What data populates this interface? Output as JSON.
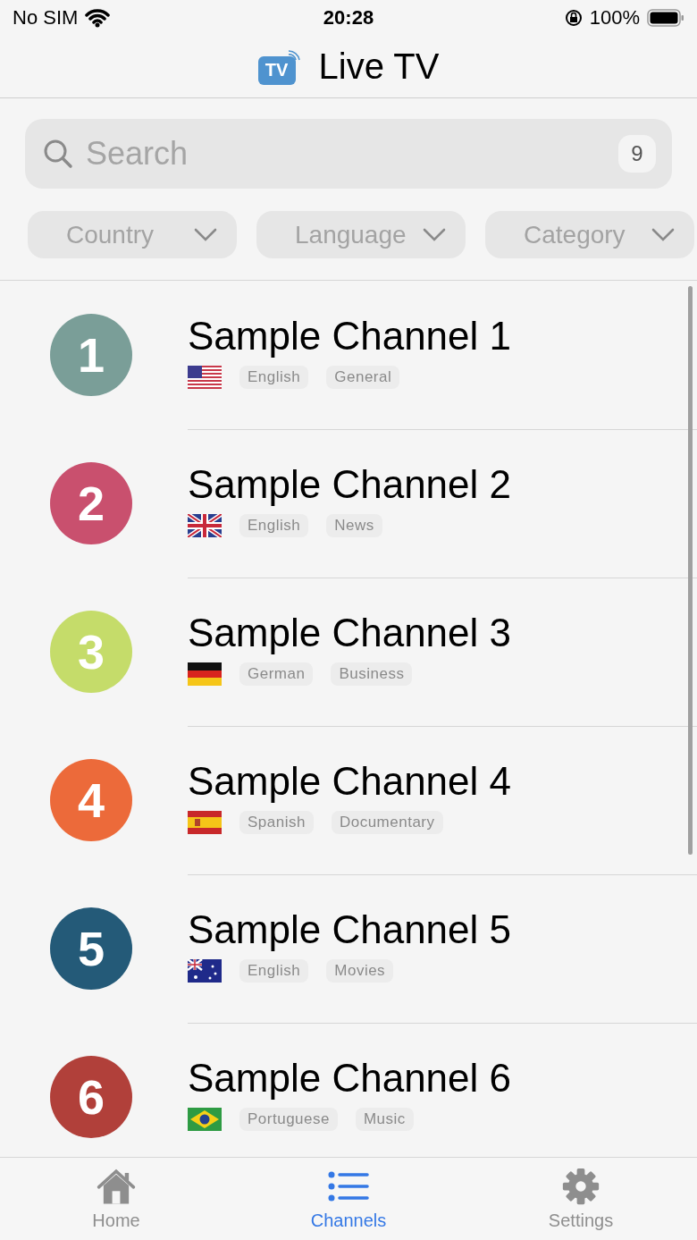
{
  "status_bar": {
    "carrier": "No SIM",
    "time": "20:28",
    "battery": "100%"
  },
  "header": {
    "title": "Live TV",
    "logo_text": "TV"
  },
  "search": {
    "placeholder": "Search",
    "count": "9"
  },
  "filters": [
    {
      "label": "Country"
    },
    {
      "label": "Language"
    },
    {
      "label": "Category"
    }
  ],
  "channels": [
    {
      "number": "1",
      "color": "#7a9e98",
      "name": "Sample Channel 1",
      "kind": "us",
      "language": "English",
      "category": "General"
    },
    {
      "number": "2",
      "color": "#c9506e",
      "name": "Sample Channel 2",
      "kind": "uk",
      "language": "English",
      "category": "News"
    },
    {
      "number": "3",
      "color": "#c5dc6a",
      "name": "Sample Channel 3",
      "kind": "de",
      "language": "German",
      "category": "Business"
    },
    {
      "number": "4",
      "color": "#ec6a3a",
      "name": "Sample Channel 4",
      "kind": "es",
      "language": "Spanish",
      "category": "Documentary"
    },
    {
      "number": "5",
      "color": "#245a78",
      "name": "Sample Channel 5",
      "kind": "au",
      "language": "English",
      "category": "Movies"
    },
    {
      "number": "6",
      "color": "#b1403a",
      "name": "Sample Channel 6",
      "kind": "br",
      "language": "Portuguese",
      "category": "Music"
    }
  ],
  "tabs": [
    {
      "label": "Home",
      "kind": "home",
      "selected": false
    },
    {
      "label": "Channels",
      "kind": "list",
      "selected": true
    },
    {
      "label": "Settings",
      "kind": "gear",
      "selected": false
    }
  ]
}
